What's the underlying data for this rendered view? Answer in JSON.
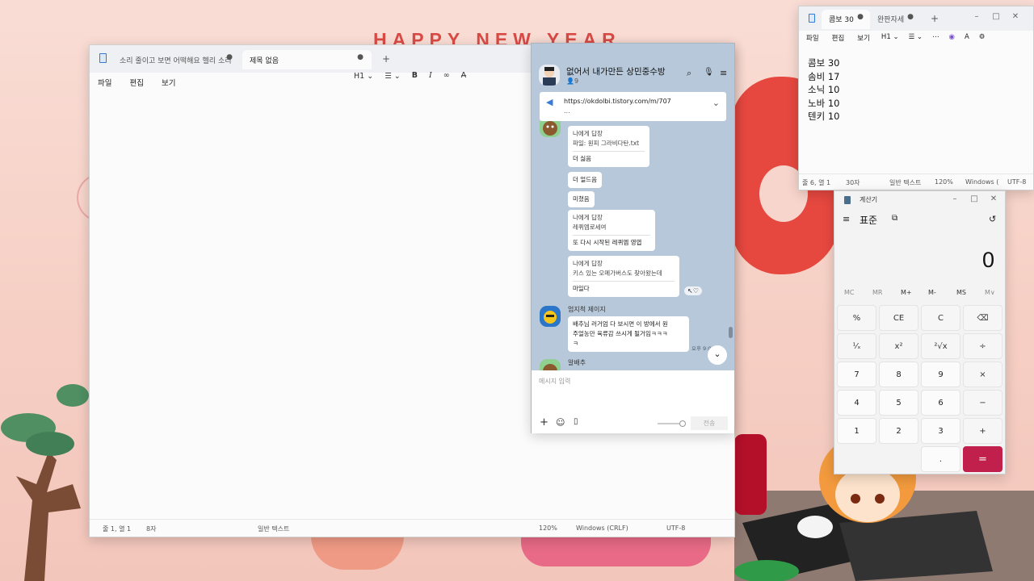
{
  "wallpaper": {
    "greeting": "HAPPY NEW YEAR"
  },
  "notepad_main": {
    "tabs": [
      {
        "label": "소리 줄이고 보면 어떡해요 헬리 소리"
      },
      {
        "label": "제목 없음"
      }
    ],
    "new_tab": "+",
    "menu": [
      "파일",
      "편집",
      "보기"
    ],
    "heading_select": "H1",
    "status": {
      "pos": "줄 1, 열 1",
      "chars": "8자",
      "type": "일반 텍스트",
      "zoom": "120%",
      "eol": "Windows (CRLF)",
      "enc": "UTF-8"
    }
  },
  "chat": {
    "title": "없어서 내가만든 상민중수방",
    "members": "9",
    "notice_link": "https://okdolbi.tistory.com/m/707",
    "notice_more": "...",
    "messages": [
      {
        "reply_to": "나에게 답장",
        "quote": "파일: 원피 그라비다탄.txt",
        "text": "더 싫음"
      },
      {
        "text": "더 얼드음"
      },
      {
        "text": "미쳤음"
      },
      {
        "reply_to": "나에게 답장",
        "quote": "레퀴엠로세여",
        "text": "또 다시 시작된 레퀴엠 영엽"
      },
      {
        "reply_to": "나에게 답장",
        "quote": "키스 있는 오메가버스도 찾아왔는데",
        "text": "마일다"
      }
    ],
    "sender2": "엄지척 제이지",
    "msg2": [
      "배추님 러거엄 다 보시면 이 방에서 원",
      "주얼농만 육류감 쓰시게 될거임ㅋㅋㅋ",
      "ㅋ"
    ],
    "time2": "오후 9:02",
    "sender3": "알배추",
    "input_placeholder": "메시지 입력",
    "send_label": "전송",
    "colors": {
      "bg": "#b6c8da",
      "bubble": "#ffffff"
    }
  },
  "notepad_small": {
    "tabs": [
      {
        "label": "콤보 30"
      },
      {
        "label": "완판자세"
      }
    ],
    "new_tab": "+",
    "menu": [
      "파일",
      "편집",
      "보기"
    ],
    "heading_select": "H1",
    "lines": [
      "콤보 30",
      "솜비 17",
      "소닉 10",
      "노바 10",
      "텐키 10"
    ],
    "status": {
      "pos": "줄 6, 열 1",
      "chars": "30자",
      "type": "일반 텍스트",
      "zoom": "120%",
      "eol": "Windows (",
      "enc": "UTF-8"
    }
  },
  "calculator": {
    "title": "계산기",
    "mode": "표준",
    "display": "0",
    "memory": [
      "MC",
      "MR",
      "M+",
      "M-",
      "MS",
      "M∨"
    ],
    "keys": [
      "%",
      "CE",
      "C",
      "⌫",
      "¹⁄ₓ",
      "x²",
      "²√x",
      "÷",
      "7",
      "8",
      "9",
      "×",
      "4",
      "5",
      "6",
      "−",
      "1",
      "2",
      "3",
      "+",
      "",
      "",
      ".",
      "="
    ],
    "accent": "#c0204b"
  }
}
